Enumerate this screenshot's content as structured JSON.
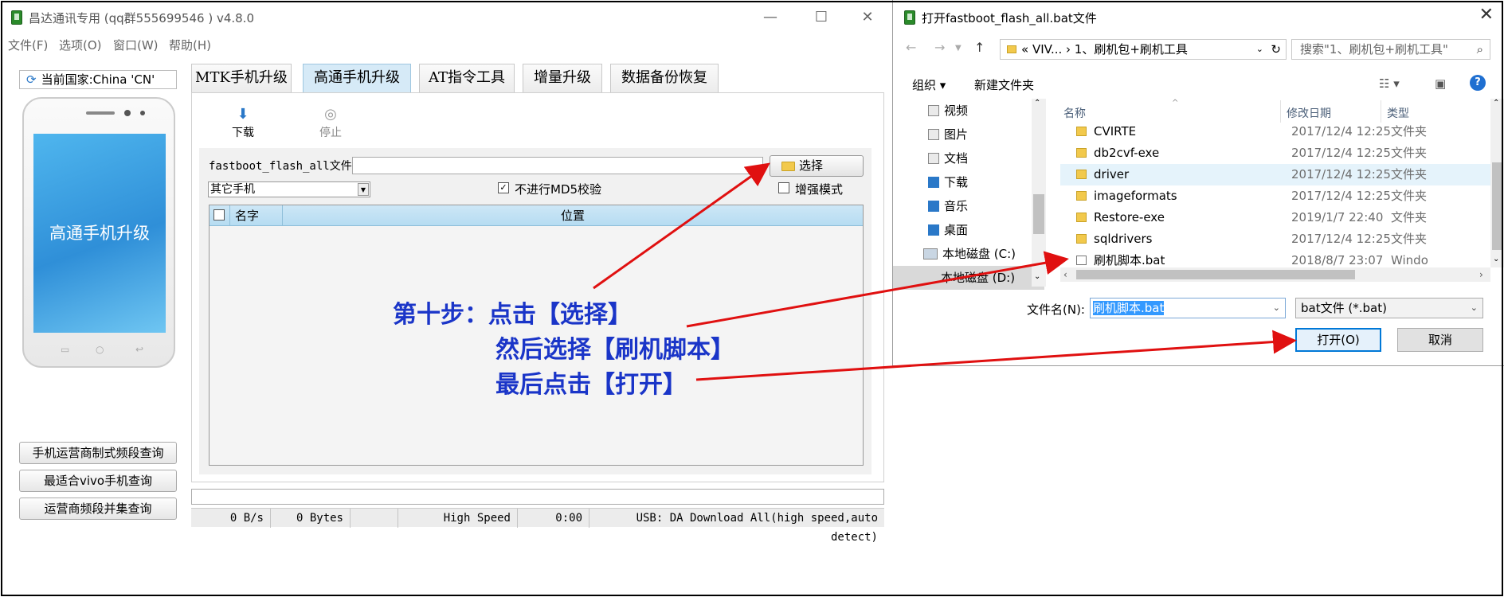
{
  "main_window": {
    "title": "昌达通讯专用    (qq群555699546 ) v4.8.0",
    "controls": {
      "minimize": "—",
      "maximize": "☐",
      "close": "✕"
    },
    "menu": [
      "文件(F)",
      "选项(O)",
      "窗口(W)",
      "帮助(H)"
    ]
  },
  "left_panel": {
    "country": "当前国家:China 'CN'",
    "phone_screen_text": "高通手机升级",
    "buttons": [
      "手机运营商制式频段查询",
      "最适合vivo手机查询",
      "运营商频段并集查询"
    ]
  },
  "tabs": [
    "MTK手机升级",
    "高通手机升级",
    "AT指令工具",
    "增量升级",
    "数据备份恢复"
  ],
  "active_tab": 1,
  "toolbar": {
    "download": "下载",
    "stop": "停止"
  },
  "form": {
    "fastboot_label": "fastboot_flash_all文件",
    "fastboot_value": "",
    "select_button": "选择",
    "phone_select": "其它手机",
    "skip_md5": "不进行MD5校验",
    "skip_md5_checked": true,
    "enhanced_mode": "增强模式",
    "enhanced_checked": false
  },
  "table": {
    "col_name": "名字",
    "col_location": "位置"
  },
  "status": {
    "speed": "0 B/s",
    "bytes": "0 Bytes",
    "empty": "",
    "mode": "High Speed",
    "time": "0:00",
    "message": "USB: DA Download All(high speed,auto detect)"
  },
  "dialog": {
    "title": "打开fastboot_flash_all.bat文件",
    "close": "✕",
    "address": "«  VIV...  ›  1、刷机包+刷机工具",
    "search_placeholder": "搜索\"1、刷机包+刷机工具\"",
    "organize": "组织 ▾",
    "new_folder": "新建文件夹",
    "nav_items": [
      "视频",
      "图片",
      "文档",
      "下载",
      "音乐",
      "桌面",
      "本地磁盘 (C:)",
      "本地磁盘 (D:)"
    ],
    "columns": {
      "name": "名称",
      "date": "修改日期",
      "type": "类型"
    },
    "files": [
      {
        "name": "CVIRTE",
        "date": "2017/12/4 12:25",
        "type": "文件夹",
        "kind": "folder"
      },
      {
        "name": "db2cvf-exe",
        "date": "2017/12/4 12:25",
        "type": "文件夹",
        "kind": "folder"
      },
      {
        "name": "driver",
        "date": "2017/12/4 12:25",
        "type": "文件夹",
        "kind": "folder"
      },
      {
        "name": "imageformats",
        "date": "2017/12/4 12:25",
        "type": "文件夹",
        "kind": "folder"
      },
      {
        "name": "Restore-exe",
        "date": "2019/1/7 22:40",
        "type": "文件夹",
        "kind": "folder"
      },
      {
        "name": "sqldrivers",
        "date": "2017/12/4 12:25",
        "type": "文件夹",
        "kind": "folder"
      },
      {
        "name": "刷机脚本.bat",
        "date": "2018/8/7 23:07",
        "type": "Windo",
        "kind": "bat"
      }
    ],
    "filename_label": "文件名(N):",
    "filename_value": "刷机脚本.bat",
    "filetype": "bat文件 (*.bat)",
    "open_button": "打开(O)",
    "cancel_button": "取消"
  },
  "annotation": {
    "line1": "第十步：点击【选择】",
    "line2": "然后选择【刷机脚本】",
    "line3": "最后点击【打开】",
    "color": "#1a35c8",
    "arrow_color": "#e01010"
  }
}
